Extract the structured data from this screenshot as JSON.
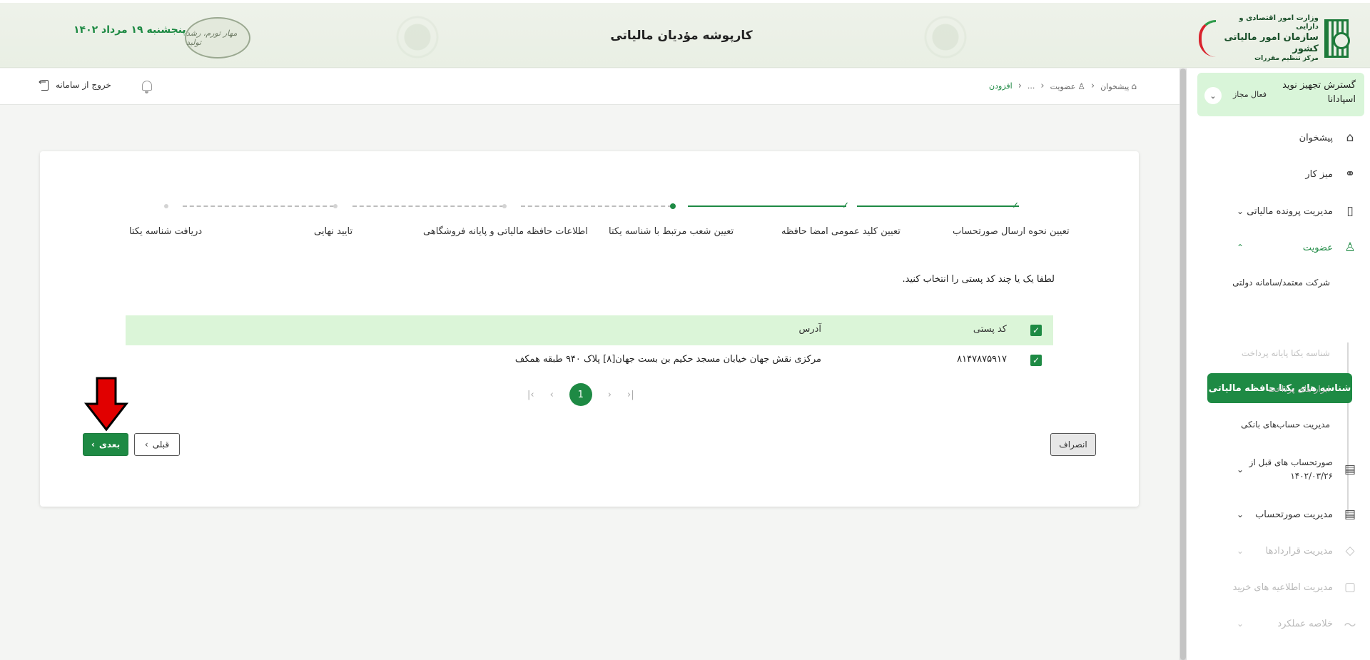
{
  "header": {
    "app_title": "کارپوشه مؤدیان مالیاتی",
    "date": "پنجشنبه ۱۹ مرداد ۱۴۰۲",
    "org_line1": "وزارت امور اقتصادی و دارایی",
    "org_line2": "سازمان امور مالیاتی کشور",
    "org_line3": "مرکز تنظیم مقررات",
    "slogan_stamp": "مهار تورم، رشد تولید"
  },
  "subbar": {
    "logout_label": "خروج از سامانه",
    "breadcrumb": [
      {
        "label": "پیشخوان",
        "icon": "home-icon"
      },
      {
        "label": "عضویت",
        "icon": "user-icon"
      },
      {
        "label": "..."
      },
      {
        "label": "افزودن",
        "active": true
      }
    ]
  },
  "sidebar": {
    "company": {
      "name": "گسترش تجهیز نوید اسپادانا",
      "status": "فعال مجاز"
    },
    "items": [
      {
        "label": "پیشخوان",
        "icon": "home-icon"
      },
      {
        "label": "میز کار",
        "icon": "workspace-icon"
      },
      {
        "label": "مدیریت پرونده مالیاتی",
        "icon": "file-icon",
        "has_children": true
      },
      {
        "label": "عضویت",
        "icon": "user-icon",
        "expanded": true
      },
      {
        "label": "صورتحساب های قبل از ۱۴۰۲/۰۳/۲۶",
        "icon": "receipt-icon",
        "has_children": true
      },
      {
        "label": "مدیریت صورتحساب",
        "icon": "invoice-icon",
        "has_children": true
      },
      {
        "label": "مدیریت قراردادها",
        "icon": "handshake-icon",
        "disabled": true
      },
      {
        "label": "مدیریت اطلاعیه های خرید",
        "icon": "bag-icon",
        "disabled": true
      },
      {
        "label": "خلاصه عملکرد",
        "icon": "chart-icon",
        "disabled": true
      }
    ],
    "membership_children": [
      {
        "label": "شرکت معتمد/سامانه دولتی"
      },
      {
        "label": "شناسه های یکتا حافظه مالیاتی",
        "active": true
      },
      {
        "label": "شناسه یکتا پایانه پرداخت",
        "disabled": true
      },
      {
        "label": "ابزار های پرداخت",
        "disabled": true
      },
      {
        "label": "مدیریت حساب‌های بانکی"
      }
    ]
  },
  "stepper": {
    "steps": [
      {
        "label": "تعیین نحوه ارسال صورتحساب",
        "state": "done"
      },
      {
        "label": "تعیین کلید عمومی امضا حافظه",
        "state": "done"
      },
      {
        "label": "تعیین شعب مرتبط با شناسه یکتا",
        "state": "current"
      },
      {
        "label": "اطلاعات حافظه مالیاتی و پایانه فروشگاهی",
        "state": "pending"
      },
      {
        "label": "تایید نهایی",
        "state": "pending"
      },
      {
        "label": "دریافت شناسه یکتا",
        "state": "pending"
      }
    ]
  },
  "content": {
    "instruction": "لطفا یک یا چند کد پستی را انتخاب کنید.",
    "table": {
      "headers": {
        "postal_code": "کد پستی",
        "address": "آدرس"
      },
      "rows": [
        {
          "checked": true,
          "postal_code": "۸۱۴۷۸۷۵۹۱۷",
          "address": "مرکزی نقش جهان خیابان مسجد حکیم بن بست جهان[۸] پلاک ۹۴۰ طبقه همکف"
        }
      ]
    },
    "pagination": {
      "current_page": "1"
    },
    "buttons": {
      "next": "بعدی",
      "prev": "قبلی",
      "cancel": "انصراف"
    }
  },
  "colors": {
    "accent": "#1e8a44",
    "accent_light": "#dbf5d8",
    "annotation_arrow": "#e10000"
  }
}
